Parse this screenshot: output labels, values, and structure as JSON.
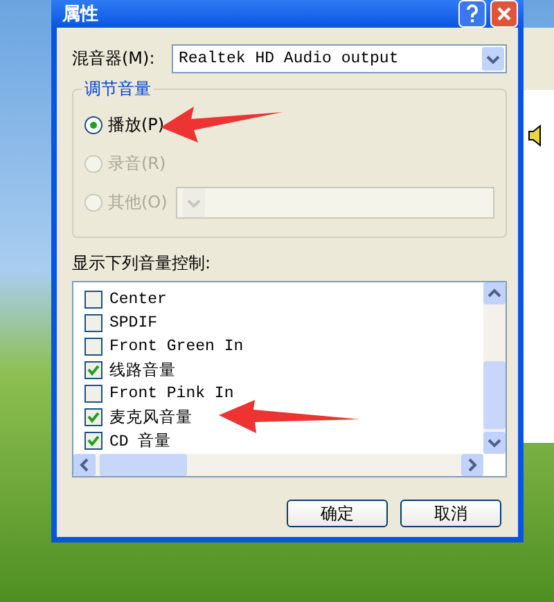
{
  "window": {
    "title": "属性"
  },
  "mixer": {
    "label": "混音器(M):",
    "value": "Realtek HD Audio output"
  },
  "volume_group": {
    "title": "调节音量",
    "options": [
      {
        "label": "播放(P)",
        "selected": true,
        "disabled": false
      },
      {
        "label": "录音(R)",
        "selected": false,
        "disabled": true
      },
      {
        "label": "其他(O)",
        "selected": false,
        "disabled": true
      }
    ],
    "other_select": {
      "disabled": true
    }
  },
  "controls_label": "显示下列音量控制:",
  "controls": [
    {
      "label": "Center",
      "checked": false
    },
    {
      "label": "SPDIF",
      "checked": false
    },
    {
      "label": "Front Green In",
      "checked": false
    },
    {
      "label": "线路音量",
      "checked": true
    },
    {
      "label": "Front Pink In",
      "checked": false
    },
    {
      "label": "麦克风音量",
      "checked": true
    },
    {
      "label": "CD 音量",
      "checked": true
    }
  ],
  "buttons": [
    "确定",
    "取消"
  ]
}
